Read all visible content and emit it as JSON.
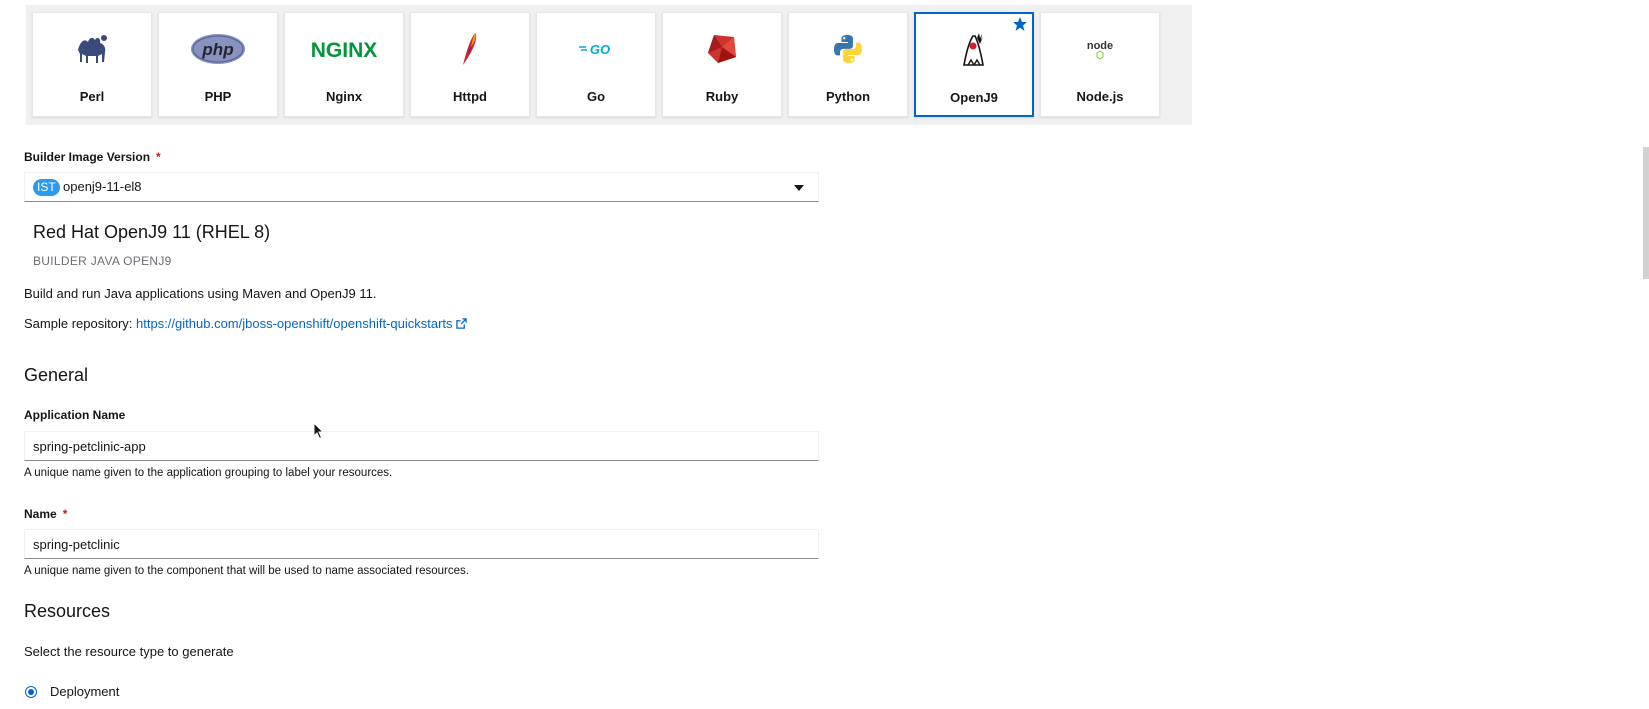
{
  "builder_tiles": [
    {
      "label": "Perl",
      "icon": "camel-icon"
    },
    {
      "label": "PHP",
      "icon": "php-icon"
    },
    {
      "label": "Nginx",
      "icon": "nginx-icon"
    },
    {
      "label": "Httpd",
      "icon": "feather-icon"
    },
    {
      "label": "Go",
      "icon": "go-icon"
    },
    {
      "label": "Ruby",
      "icon": "ruby-icon"
    },
    {
      "label": "Python",
      "icon": "python-icon"
    },
    {
      "label": "OpenJ9",
      "icon": "duke-icon",
      "selected": true
    },
    {
      "label": "Node.js",
      "icon": "nodejs-icon"
    }
  ],
  "builder_image_version": {
    "label": "Builder Image Version",
    "required_marker": "*",
    "badge": "IST",
    "value": "openj9-11-el8"
  },
  "image_details": {
    "title": "Red Hat OpenJ9 11 (RHEL 8)",
    "tags": "BUILDER JAVA OPENJ9",
    "description": "Build and run Java applications using Maven and OpenJ9 11.",
    "sample_prefix": "Sample repository:",
    "sample_link": "https://github.com/jboss-openshift/openshift-quickstarts"
  },
  "general": {
    "heading": "General",
    "application_name": {
      "label": "Application Name",
      "value": "spring-petclinic-app",
      "helper": "A unique name given to the application grouping to label your resources."
    },
    "name": {
      "label": "Name",
      "required_marker": "*",
      "value": "spring-petclinic",
      "helper": "A unique name given to the component that will be used to name associated resources."
    }
  },
  "resources": {
    "heading": "Resources",
    "prompt": "Select the resource type to generate",
    "option_deployment": "Deployment"
  },
  "colors": {
    "accent": "#0066cc",
    "required": "#c9190b",
    "badge": "#2b9af3"
  }
}
